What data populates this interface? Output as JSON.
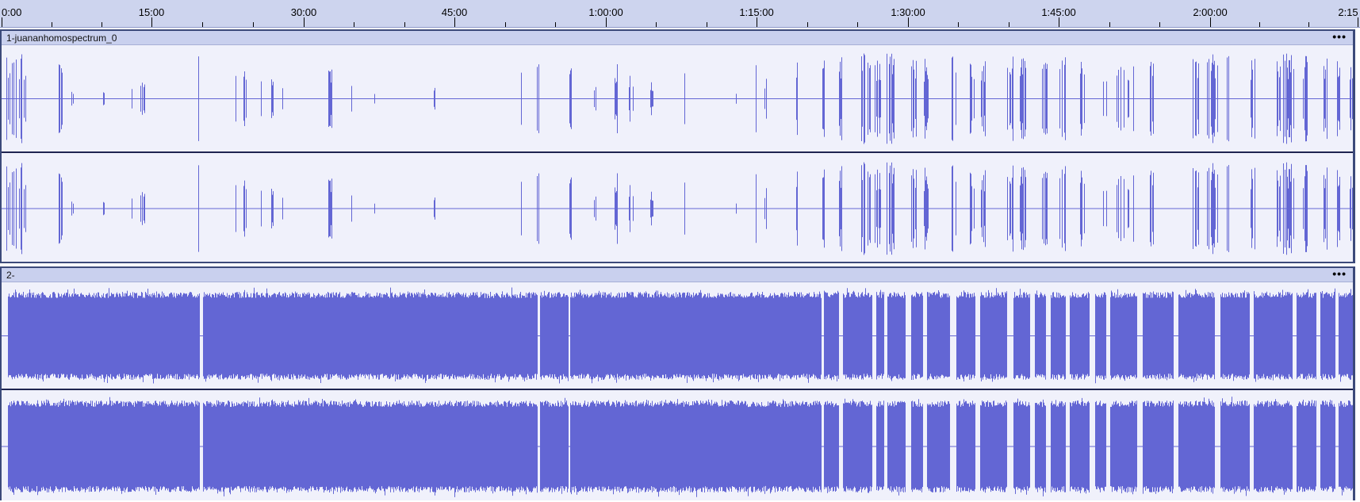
{
  "timeline": {
    "labels": [
      "0:00",
      "15:00",
      "30:00",
      "45:00",
      "1:00:00",
      "1:15:00",
      "1:30:00",
      "1:45:00",
      "2:00:00",
      "2:15"
    ]
  },
  "tracks": [
    {
      "name": "1-juananhomospectrum_0",
      "menu_icon": "•••"
    },
    {
      "name": "2-",
      "menu_icon": "•••"
    }
  ],
  "colors": {
    "waveform": "#6366d4",
    "track_background": "#f0f1fb",
    "header_background": "#c9d0ee",
    "timeline_background": "#cdd4ee"
  }
}
